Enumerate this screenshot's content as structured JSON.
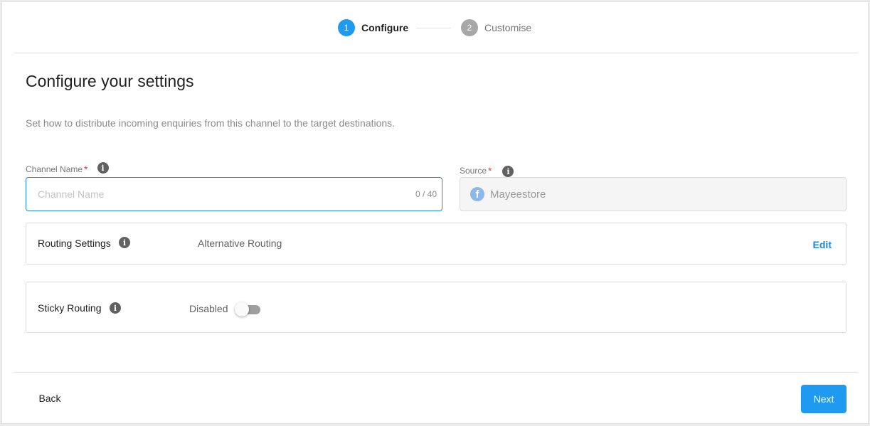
{
  "stepper": {
    "steps": [
      {
        "number": "1",
        "label": "Configure",
        "state": "active"
      },
      {
        "number": "2",
        "label": "Customise",
        "state": "inactive"
      }
    ]
  },
  "page": {
    "title": "Configure your settings",
    "subtitle": "Set how to distribute incoming enquiries from this channel to the target destinations."
  },
  "channel_name": {
    "label": "Channel Name",
    "required_mark": "*",
    "placeholder": "Channel Name",
    "value": "",
    "char_count": "0 / 40"
  },
  "source": {
    "label": "Source",
    "required_mark": "*",
    "icon": "facebook-icon",
    "value": "Mayeestore"
  },
  "routing_settings": {
    "label": "Routing Settings",
    "value": "Alternative Routing",
    "edit_label": "Edit"
  },
  "sticky_routing": {
    "label": "Sticky Routing",
    "status": "Disabled",
    "enabled": false
  },
  "footer": {
    "back_label": "Back",
    "next_label": "Next"
  },
  "icons": {
    "info": "i",
    "facebook": "f"
  },
  "colors": {
    "primary": "#1e9bf0",
    "link": "#1e88e5",
    "required": "#e53935",
    "inactive_step": "#a7a7a7"
  }
}
